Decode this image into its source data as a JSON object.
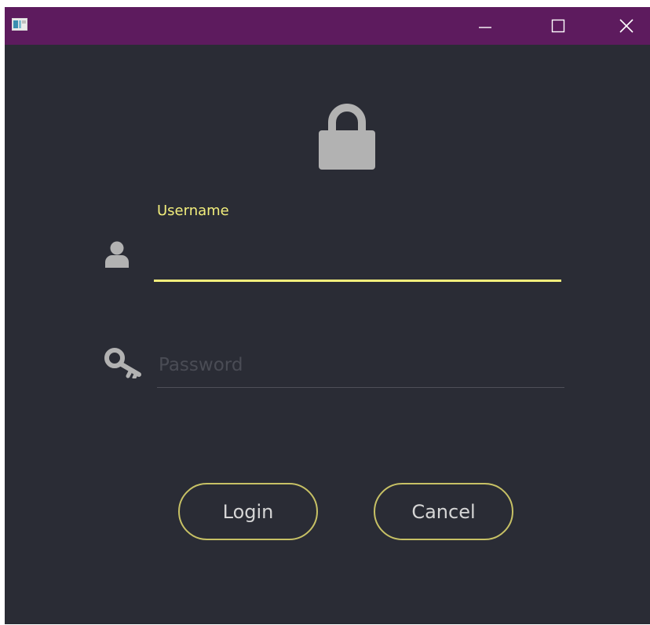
{
  "window": {
    "controls": {
      "minimize_icon": "minimize-icon",
      "maximize_icon": "maximize-icon",
      "close_icon": "close-icon"
    }
  },
  "form": {
    "username": {
      "label": "Username",
      "value": "",
      "icon": "user-icon"
    },
    "password": {
      "placeholder": "Password",
      "value": "",
      "icon": "key-icon"
    },
    "header_icon": "lock-icon"
  },
  "buttons": {
    "login": "Login",
    "cancel": "Cancel"
  },
  "colors": {
    "titlebar": "#5d1b5e",
    "background": "#2a2c35",
    "accent": "#f2ee7c",
    "button_border": "#c7c165",
    "icon_gray": "#b2b2b2"
  }
}
